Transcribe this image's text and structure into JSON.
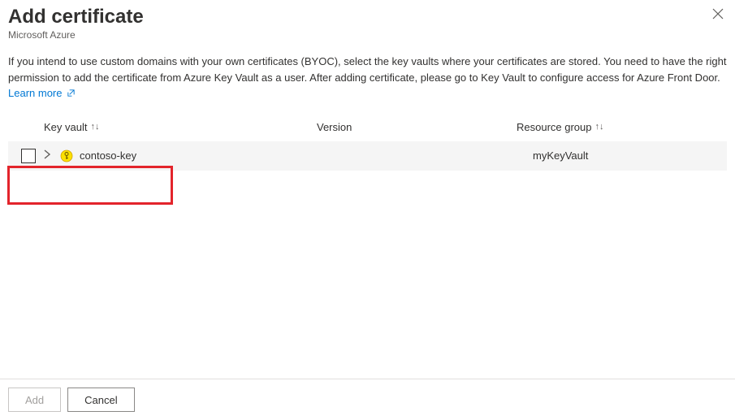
{
  "header": {
    "title": "Add certificate",
    "subtitle": "Microsoft Azure"
  },
  "description": {
    "text": "If you intend to use custom domains with your own certificates (BYOC), select the key vaults where your certificates are stored. You need to have the right permission to add the certificate from Azure Key Vault as a user. After adding certificate, please go to Key Vault to configure access for Azure Front Door.",
    "learn_more": "Learn more"
  },
  "table": {
    "columns": {
      "key_vault": "Key vault",
      "version": "Version",
      "resource_group": "Resource group"
    },
    "rows": [
      {
        "name": "contoso-key",
        "version": "",
        "resource_group": "myKeyVault"
      }
    ]
  },
  "footer": {
    "add": "Add",
    "cancel": "Cancel"
  }
}
